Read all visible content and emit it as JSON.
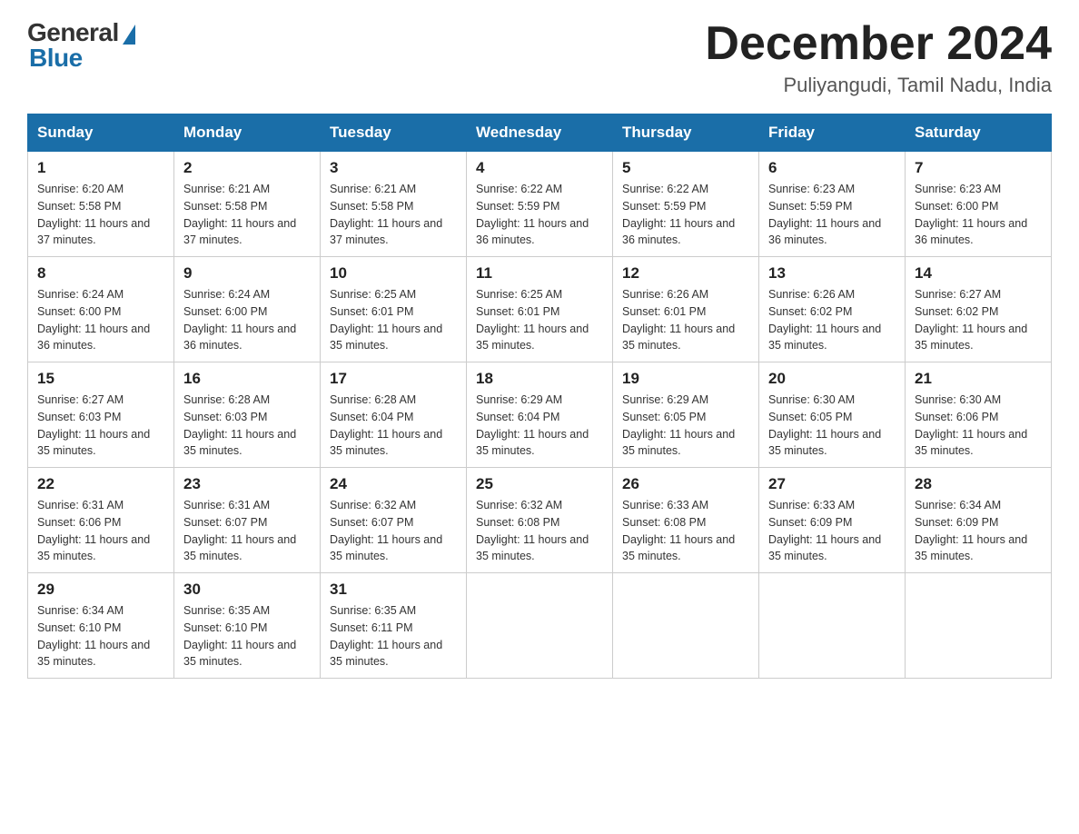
{
  "logo": {
    "general": "General",
    "blue": "Blue"
  },
  "title": "December 2024",
  "location": "Puliyangudi, Tamil Nadu, India",
  "weekdays": [
    "Sunday",
    "Monday",
    "Tuesday",
    "Wednesday",
    "Thursday",
    "Friday",
    "Saturday"
  ],
  "weeks": [
    [
      {
        "day": "1",
        "sunrise": "6:20 AM",
        "sunset": "5:58 PM",
        "daylight": "11 hours and 37 minutes."
      },
      {
        "day": "2",
        "sunrise": "6:21 AM",
        "sunset": "5:58 PM",
        "daylight": "11 hours and 37 minutes."
      },
      {
        "day": "3",
        "sunrise": "6:21 AM",
        "sunset": "5:58 PM",
        "daylight": "11 hours and 37 minutes."
      },
      {
        "day": "4",
        "sunrise": "6:22 AM",
        "sunset": "5:59 PM",
        "daylight": "11 hours and 36 minutes."
      },
      {
        "day": "5",
        "sunrise": "6:22 AM",
        "sunset": "5:59 PM",
        "daylight": "11 hours and 36 minutes."
      },
      {
        "day": "6",
        "sunrise": "6:23 AM",
        "sunset": "5:59 PM",
        "daylight": "11 hours and 36 minutes."
      },
      {
        "day": "7",
        "sunrise": "6:23 AM",
        "sunset": "6:00 PM",
        "daylight": "11 hours and 36 minutes."
      }
    ],
    [
      {
        "day": "8",
        "sunrise": "6:24 AM",
        "sunset": "6:00 PM",
        "daylight": "11 hours and 36 minutes."
      },
      {
        "day": "9",
        "sunrise": "6:24 AM",
        "sunset": "6:00 PM",
        "daylight": "11 hours and 36 minutes."
      },
      {
        "day": "10",
        "sunrise": "6:25 AM",
        "sunset": "6:01 PM",
        "daylight": "11 hours and 35 minutes."
      },
      {
        "day": "11",
        "sunrise": "6:25 AM",
        "sunset": "6:01 PM",
        "daylight": "11 hours and 35 minutes."
      },
      {
        "day": "12",
        "sunrise": "6:26 AM",
        "sunset": "6:01 PM",
        "daylight": "11 hours and 35 minutes."
      },
      {
        "day": "13",
        "sunrise": "6:26 AM",
        "sunset": "6:02 PM",
        "daylight": "11 hours and 35 minutes."
      },
      {
        "day": "14",
        "sunrise": "6:27 AM",
        "sunset": "6:02 PM",
        "daylight": "11 hours and 35 minutes."
      }
    ],
    [
      {
        "day": "15",
        "sunrise": "6:27 AM",
        "sunset": "6:03 PM",
        "daylight": "11 hours and 35 minutes."
      },
      {
        "day": "16",
        "sunrise": "6:28 AM",
        "sunset": "6:03 PM",
        "daylight": "11 hours and 35 minutes."
      },
      {
        "day": "17",
        "sunrise": "6:28 AM",
        "sunset": "6:04 PM",
        "daylight": "11 hours and 35 minutes."
      },
      {
        "day": "18",
        "sunrise": "6:29 AM",
        "sunset": "6:04 PM",
        "daylight": "11 hours and 35 minutes."
      },
      {
        "day": "19",
        "sunrise": "6:29 AM",
        "sunset": "6:05 PM",
        "daylight": "11 hours and 35 minutes."
      },
      {
        "day": "20",
        "sunrise": "6:30 AM",
        "sunset": "6:05 PM",
        "daylight": "11 hours and 35 minutes."
      },
      {
        "day": "21",
        "sunrise": "6:30 AM",
        "sunset": "6:06 PM",
        "daylight": "11 hours and 35 minutes."
      }
    ],
    [
      {
        "day": "22",
        "sunrise": "6:31 AM",
        "sunset": "6:06 PM",
        "daylight": "11 hours and 35 minutes."
      },
      {
        "day": "23",
        "sunrise": "6:31 AM",
        "sunset": "6:07 PM",
        "daylight": "11 hours and 35 minutes."
      },
      {
        "day": "24",
        "sunrise": "6:32 AM",
        "sunset": "6:07 PM",
        "daylight": "11 hours and 35 minutes."
      },
      {
        "day": "25",
        "sunrise": "6:32 AM",
        "sunset": "6:08 PM",
        "daylight": "11 hours and 35 minutes."
      },
      {
        "day": "26",
        "sunrise": "6:33 AM",
        "sunset": "6:08 PM",
        "daylight": "11 hours and 35 minutes."
      },
      {
        "day": "27",
        "sunrise": "6:33 AM",
        "sunset": "6:09 PM",
        "daylight": "11 hours and 35 minutes."
      },
      {
        "day": "28",
        "sunrise": "6:34 AM",
        "sunset": "6:09 PM",
        "daylight": "11 hours and 35 minutes."
      }
    ],
    [
      {
        "day": "29",
        "sunrise": "6:34 AM",
        "sunset": "6:10 PM",
        "daylight": "11 hours and 35 minutes."
      },
      {
        "day": "30",
        "sunrise": "6:35 AM",
        "sunset": "6:10 PM",
        "daylight": "11 hours and 35 minutes."
      },
      {
        "day": "31",
        "sunrise": "6:35 AM",
        "sunset": "6:11 PM",
        "daylight": "11 hours and 35 minutes."
      },
      null,
      null,
      null,
      null
    ]
  ]
}
